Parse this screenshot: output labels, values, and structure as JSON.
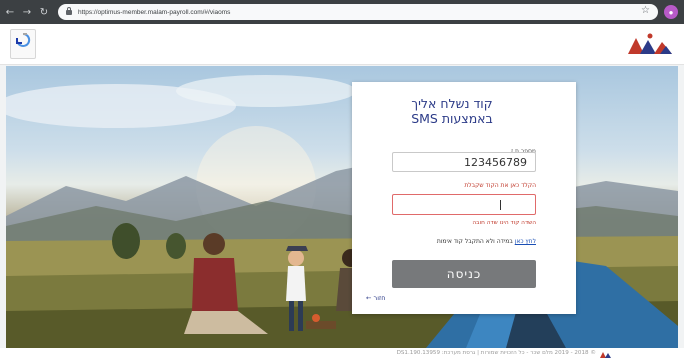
{
  "browser": {
    "url": "https://optimus-member.malam-payroll.com/#/viaoms"
  },
  "card": {
    "title_line1": "קוד נשלח אליך",
    "title_line2": "באמצעות SMS",
    "id_label": "מספר ת.ז",
    "id_value": "123456789",
    "code_label": "הקלד כאן את הקוד שקבלת",
    "code_placeholder": "",
    "error_text": "השדה קוד הינו שדה חובה",
    "hint_link": "לחץ כאן",
    "hint_rest": "במידה ולא התקבל קוד אימות",
    "submit_label": "כניסה",
    "back_label": "חזור"
  },
  "footer": {
    "text": "© 2018 - 2019 מלם שכר - כל הזכויות שמורות | גרסת מערכת: 13959.DS1.190"
  },
  "colors": {
    "accent": "#2c3b88",
    "error": "#c0392b",
    "button": "#77797b"
  }
}
